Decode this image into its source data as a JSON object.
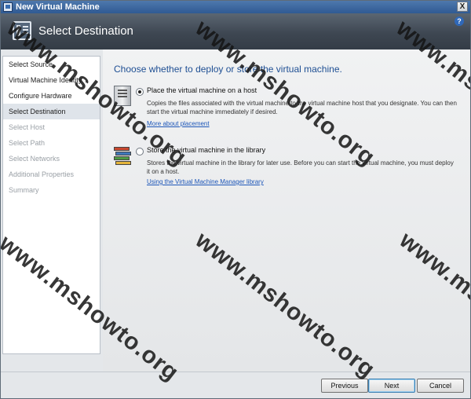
{
  "window": {
    "title": "New Virtual Machine",
    "close_glyph": "X"
  },
  "banner": {
    "heading": "Select Destination",
    "icon": "wizard-page-icon",
    "help_glyph": "?"
  },
  "nav": {
    "items": [
      {
        "label": "Select Source",
        "state": "normal"
      },
      {
        "label": "Virtual Machine Identity",
        "state": "normal"
      },
      {
        "label": "Configure Hardware",
        "state": "normal"
      },
      {
        "label": "Select Destination",
        "state": "active"
      },
      {
        "label": "Select Host",
        "state": "disabled"
      },
      {
        "label": "Select Path",
        "state": "disabled"
      },
      {
        "label": "Select Networks",
        "state": "disabled"
      },
      {
        "label": "Additional Properties",
        "state": "disabled"
      },
      {
        "label": "Summary",
        "state": "disabled"
      }
    ]
  },
  "main": {
    "question": "Choose whether to deploy or store the virtual machine.",
    "options": [
      {
        "label": "Place the virtual machine on a host",
        "checked": true,
        "icon": "server-icon",
        "description": "Copies the files associated with the virtual machine to the virtual machine host that you designate.  You can then start the virtual machine immediately if desired.",
        "link": "More about placement"
      },
      {
        "label": "Store the virtual machine in the library",
        "checked": false,
        "icon": "library-icon",
        "description": "Stores the virtual machine in the library for later use. Before you can start the virtual machine, you must deploy it on a host.",
        "link": "Using the Virtual Machine Manager library"
      }
    ]
  },
  "footer": {
    "previous_label": "Previous",
    "next_label": "Next",
    "cancel_label": "Cancel"
  },
  "watermark": {
    "text": "www.mshowto.org"
  },
  "colors": {
    "accent": "#1e4f93",
    "link": "#1d56b8",
    "titlebar": "#3a66a0",
    "banner": "#3e4752"
  }
}
